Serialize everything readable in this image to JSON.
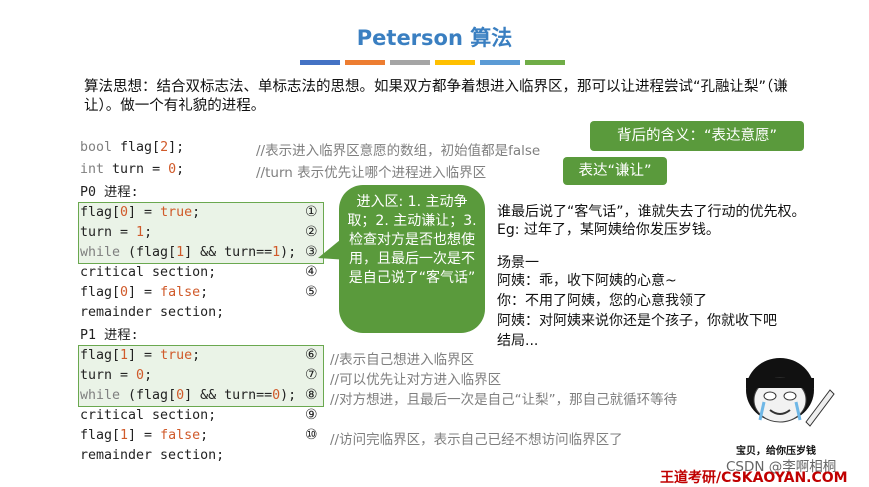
{
  "title": "Peterson 算法",
  "colors": [
    "#4472c4",
    "#ed7d31",
    "#a5a5a5",
    "#ffc000",
    "#5b9bd5",
    "#70ad47"
  ],
  "intro": "算法思想：结合双标志法、单标志法的思想。如果双方都争着想进入临界区，那可以让进程尝试“孔融让梨”（谦让）。做一个有礼貌的进程。",
  "decl": {
    "flag": {
      "kw": "bool",
      "name": " flag[",
      "num": "2",
      "rest": "];"
    },
    "turn": {
      "kw": "int",
      "name": " turn = ",
      "num": "0",
      "rest": ";"
    },
    "flag_comment": "//表示进入临界区意愿的数组，初始值都是false",
    "turn_comment": "//turn 表示优先让哪个进程进入临界区"
  },
  "callouts": {
    "flag": "背后的含义：“表达意愿”",
    "turn": "表达“谦让”"
  },
  "p0": {
    "label": "P0 进程:",
    "l1a": "flag[",
    "l1n": "0",
    "l1b": "] = ",
    "l1v": "true",
    "l1c": ";",
    "l2a": "turn = ",
    "l2n": "1",
    "l2c": ";",
    "l3kw": "while",
    "l3a": " (flag[",
    "l3n": "1",
    "l3b": "] && turn==",
    "l3n2": "1",
    "l3c": ");",
    "l4": "critical section;",
    "l5a": "flag[",
    "l5n": "0",
    "l5b": "] = ",
    "l5v": "false",
    "l5c": ";",
    "l6": "remainder section;"
  },
  "p1": {
    "label": "P1 进程:",
    "l1a": "flag[",
    "l1n": "1",
    "l1b": "] = ",
    "l1v": "true",
    "l1c": ";",
    "l2a": "turn = ",
    "l2n": "0",
    "l2c": ";",
    "l3kw": "while",
    "l3a": " (flag[",
    "l3n": "0",
    "l3b": "] && turn==",
    "l3n2": "0",
    "l3c": ");",
    "l4": "critical section;",
    "l5a": "flag[",
    "l5n": "1",
    "l5b": "] = ",
    "l5v": "false",
    "l5c": ";",
    "l6": "remainder section;"
  },
  "nums": [
    "①",
    "②",
    "③",
    "④",
    "⑤",
    "⑥",
    "⑦",
    "⑧",
    "⑨",
    "⑩"
  ],
  "p1_comments": {
    "c6": "//表示自己想进入临界区",
    "c7": "//可以优先让对方进入临界区",
    "c8": "//对方想进，且最后一次是自己“让梨”，那自己就循环等待",
    "c10": "//访问完临界区，表示自己已经不想访问临界区了"
  },
  "bubble": "进入区: 1. 主动争取；2. 主动谦让；3. 检查对方是否也想使用，且最后一次是不是自己说了“客气话”",
  "side": {
    "s1": "谁最后说了“客气话”，谁就失去了行动的优先权。",
    "s2": "Eg: 过年了，某阿姨给你发压岁钱。",
    "s3": "场景一",
    "s4": "阿姨：乖，收下阿姨的心意~",
    "s5": "你：不用了阿姨，您的心意我领了",
    "s6": "阿姨：对阿姨来说你还是个孩子，你就收下吧",
    "s7": "结局..."
  },
  "meme_caption": "宝贝，给你压岁钱",
  "watermark": "CSDN @李啊相桐",
  "brand": "王道考研/CSKAOYAN.COM"
}
